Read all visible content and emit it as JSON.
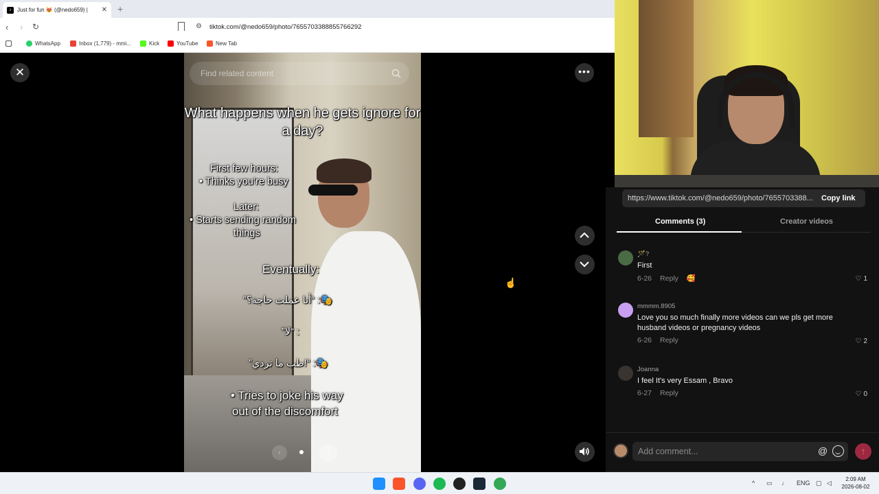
{
  "browser": {
    "tab_title": "Just for fun 😻 (@nedo659) |",
    "url": "tiktok.com/@nedo659/photo/7655703388855766292",
    "bookmarks": [
      "WhatsApp",
      "Inbox (1,779) - mmi...",
      "Kick",
      "YouTube",
      "New Tab"
    ]
  },
  "viewer": {
    "search_placeholder": "Find related content",
    "overlay": {
      "title": "What happens when he gets ignore for a day?",
      "first_hours_head": "First few hours:",
      "first_hours_item": "• Thinks you’re busy",
      "later_head": "Later:",
      "later_item_1": "• Starts sending random",
      "later_item_2": "things",
      "eventually_head": "Eventually:",
      "line_a": "”أنا عملت حاجة؟“ :🎭",
      "line_b": "”لا“ :",
      "line_c": "”طب ما تردي!“ :🎭",
      "last_item_1": "• Tries to joke his way",
      "last_item_2": "out of the discomfort"
    }
  },
  "panel": {
    "share_url": "https://www.tiktok.com/@nedo659/photo/7655703388...",
    "copy_label": "Copy link",
    "tabs": [
      "Comments (3)",
      "Creator videos"
    ],
    "comments": [
      {
        "user": "🪄?",
        "text": "First",
        "date": "6-26",
        "reply": "Reply",
        "reaction": "🥰",
        "likes": "1",
        "avatar_color": "#4a6b45"
      },
      {
        "user": "mmmm.8905",
        "text": "Love you so much finally more videos can we pls get more husband videos or pregnancy videos",
        "date": "6-26",
        "reply": "Reply",
        "likes": "2",
        "avatar_color": "#c9a0f0"
      },
      {
        "user": "Joanna",
        "text": "I feel It's very Essam , Bravo",
        "date": "6-27",
        "reply": "Reply",
        "likes": "0",
        "avatar_color": "#3a3431"
      }
    ],
    "add_comment_placeholder": "Add comment..."
  },
  "taskbar": {
    "lang": "ENG",
    "time": "2:09 AM",
    "date": "2026-08-02"
  }
}
